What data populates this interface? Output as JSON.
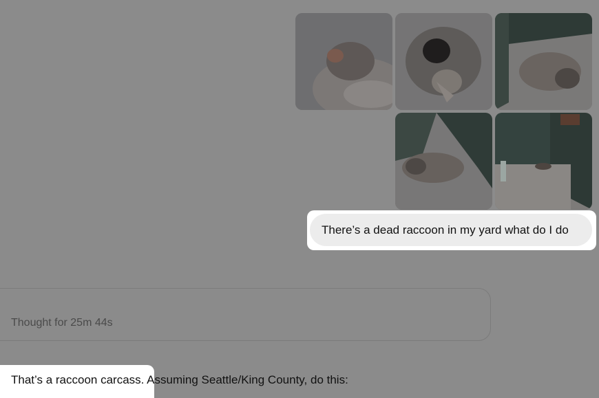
{
  "attachments": [
    {
      "subject": "raccoon-carcass-photo-1"
    },
    {
      "subject": "raccoon-carcass-photo-2"
    },
    {
      "subject": "raccoon-carcass-photo-3"
    },
    {
      "subject": "raccoon-carcass-photo-4"
    },
    {
      "subject": "raccoon-carcass-photo-5"
    }
  ],
  "user_message": "There’s a dead raccoon in my yard what do I do",
  "thought": {
    "label": "Thought for 25m 44s"
  },
  "assistant_reply": {
    "highlighted": "That’s a raccoon carcass.",
    "rest": " Assuming Seattle/King County, do this:"
  }
}
